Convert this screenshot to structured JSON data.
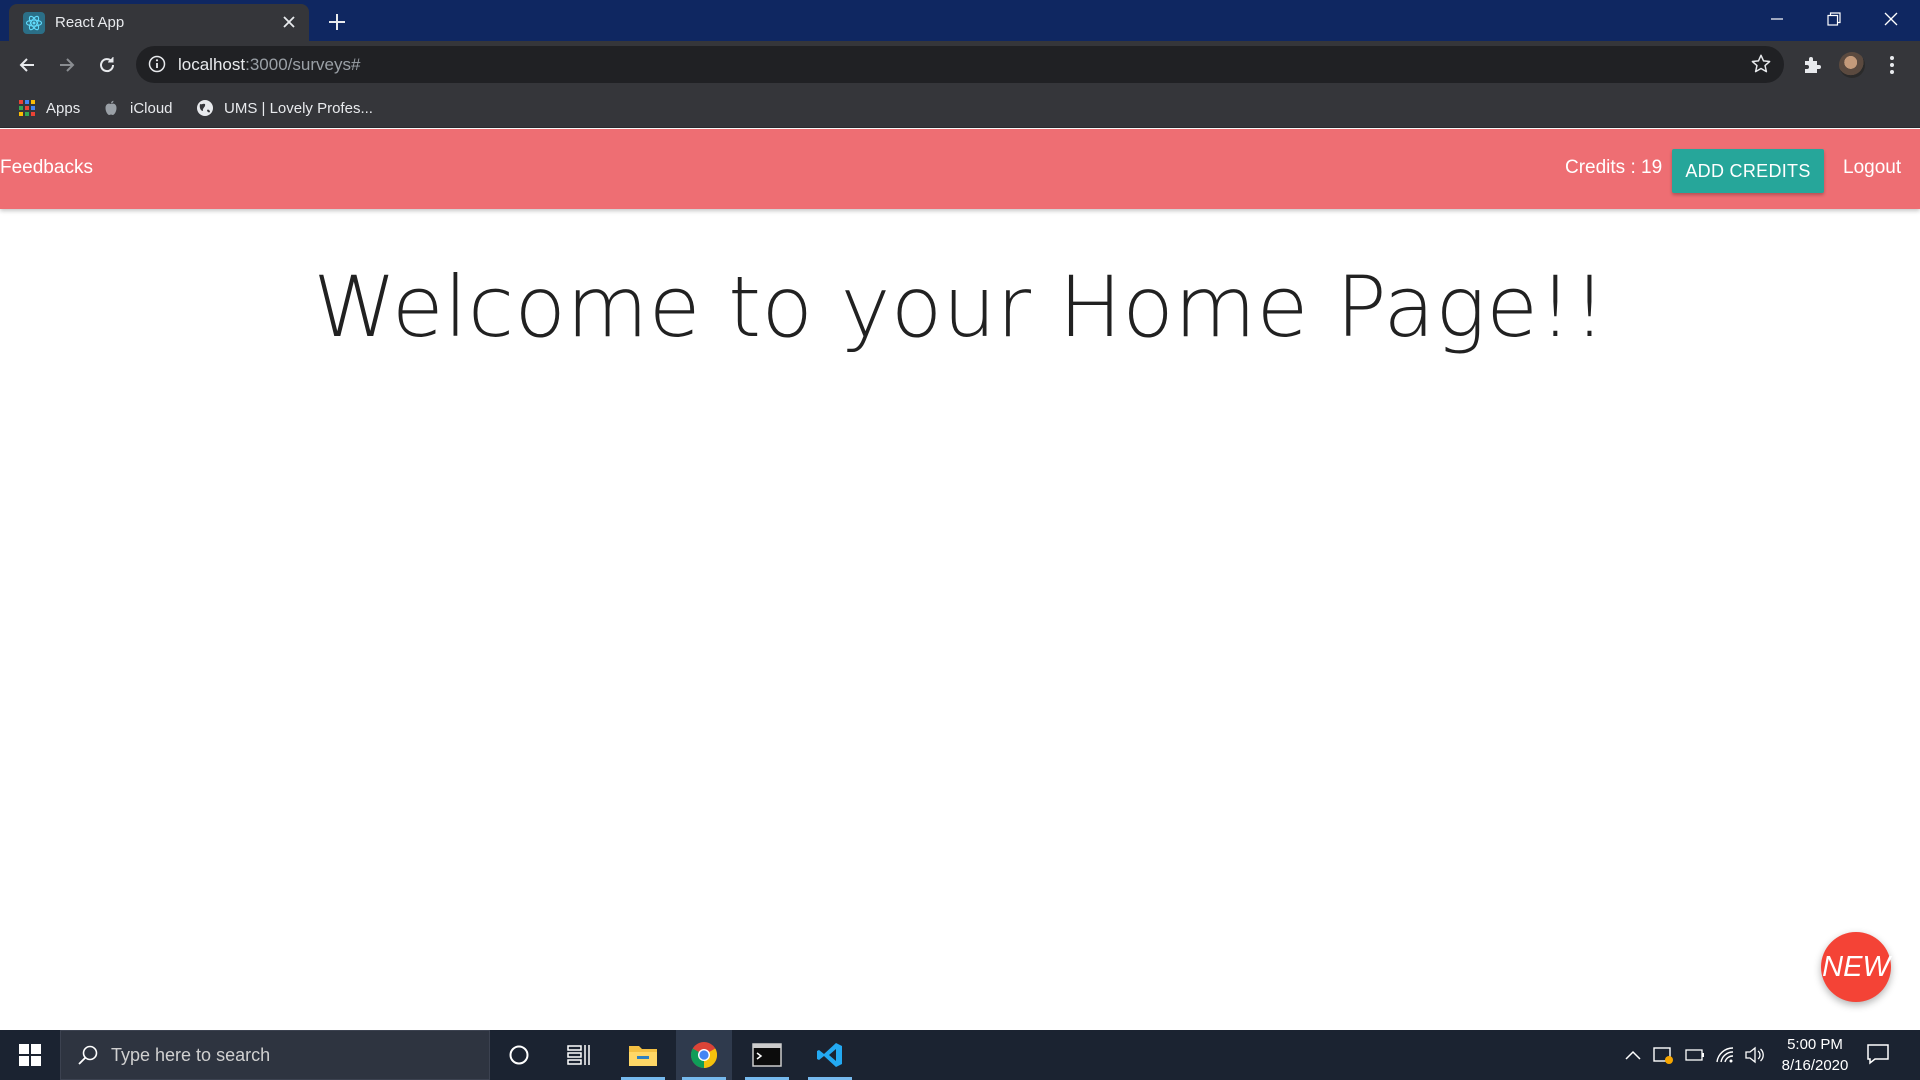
{
  "browser": {
    "tab_title": "React App",
    "url_host": "localhost",
    "url_rest": ":3000/surveys#",
    "bookmarks": {
      "apps": "Apps",
      "icloud": "iCloud",
      "ums": "UMS | Lovely Profes..."
    }
  },
  "navbar": {
    "brand": "Feedbacks",
    "credits": "Credits : 19",
    "add_credits": "ADD CREDITS",
    "logout": "Logout"
  },
  "main": {
    "heading": "Welcome to your Home Page!!",
    "fab_label": "NEW"
  },
  "taskbar": {
    "search_placeholder": "Type here to search",
    "time": "5:00 PM",
    "date": "8/16/2020"
  },
  "colors": {
    "navbar": "#ee6e73",
    "add_credits_button": "#26a69a",
    "fab": "#f44336",
    "titlebar": "#0f2761"
  }
}
